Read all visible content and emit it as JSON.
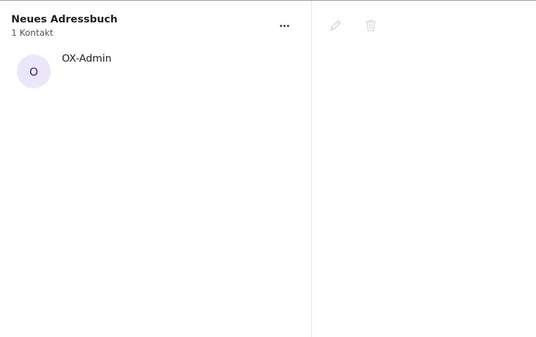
{
  "folder": {
    "title": "Neues Adressbuch",
    "count_label": "1 Kontakt"
  },
  "list_actions": {
    "more_icon": "more-horizontal-icon"
  },
  "contacts": [
    {
      "initial": "O",
      "name": "OX-Admin"
    }
  ],
  "detail_toolbar": {
    "edit_icon": "pencil-icon",
    "delete_icon": "trash-icon",
    "disabled_color": "#d8d8d8"
  },
  "colors": {
    "avatar_background": "#ece6fb",
    "avatar_text": "#3d2a7a",
    "divider": "#e4e4e4"
  }
}
